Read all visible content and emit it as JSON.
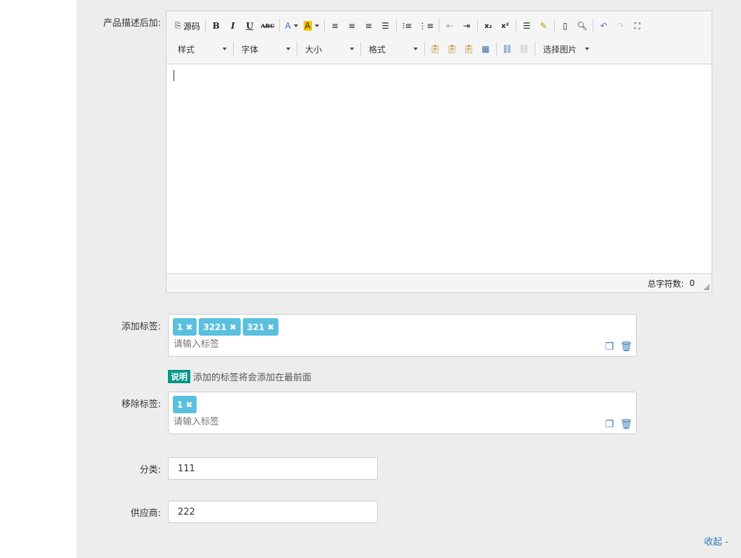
{
  "form": {
    "desc_after_label": "产品描述后加:",
    "add_tags_label": "添加标签:",
    "remove_tags_label": "移除标签:",
    "category_label": "分类:",
    "supplier_label": "供应商:"
  },
  "editor": {
    "toolbar": {
      "source": "源码",
      "style": "样式",
      "font": "字体",
      "size": "大小",
      "format": "格式",
      "select_image": "选择图片",
      "bold": "B",
      "italic": "I",
      "underline": "U",
      "strike": "ABC",
      "text_color": "A",
      "bg_color": "A",
      "subscript": "x₂",
      "superscript": "x²"
    },
    "status": {
      "word_count_label": "总字符数:",
      "word_count": "0"
    }
  },
  "add_tags": {
    "tags": [
      "1",
      "3221",
      "321"
    ],
    "placeholder": "请输入标签"
  },
  "note": {
    "badge": "说明",
    "text": "添加的标签将会添加在最前面"
  },
  "remove_tags": {
    "tags": [
      "1"
    ],
    "placeholder": "请输入标签"
  },
  "category": {
    "value": "111"
  },
  "supplier": {
    "value": "222"
  },
  "collapse_link": "收起 -",
  "colors": {
    "tag": "#5bc0de",
    "badge": "#009688",
    "link": "#337ab7"
  }
}
